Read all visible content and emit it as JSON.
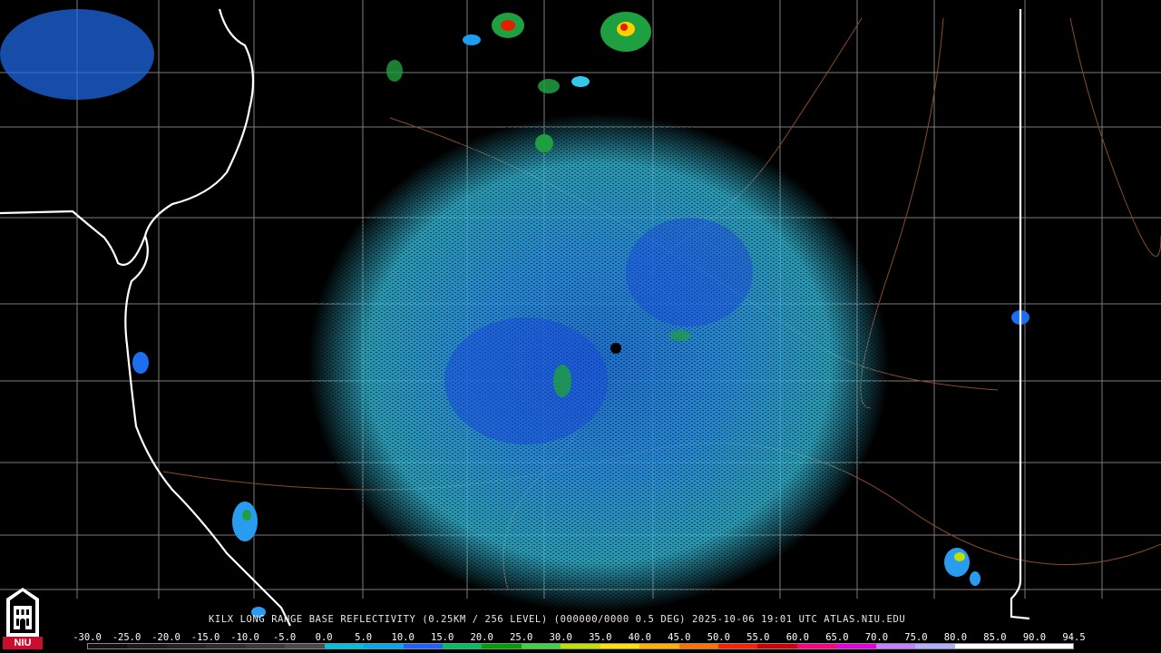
{
  "caption": "KILX LONG RANGE BASE REFLECTIVITY (0.25KM / 256 LEVEL) (000000/0000 0.5 DEG) 2025-10-06 19:01 UTC  ATLAS.NIU.EDU",
  "scale_labels": [
    "-30.0",
    "-25.0",
    "-20.0",
    "-15.0",
    "-10.0",
    "-5.0",
    "0.0",
    "5.0",
    "10.0",
    "15.0",
    "20.0",
    "25.0",
    "30.0",
    "35.0",
    "40.0",
    "45.0",
    "50.0",
    "55.0",
    "60.0",
    "65.0",
    "70.0",
    "75.0",
    "80.0",
    "85.0",
    "90.0",
    "94.5"
  ],
  "logo_text": "NIU",
  "colors": {
    "background": "#000000",
    "county_lines": "#8a8a8a",
    "state_lines": "#ffffff",
    "roads": "#8b4a2a",
    "radar_site": "#000000"
  },
  "scale_colors": [
    "#101010",
    "#1a1a1a",
    "#242424",
    "#2e2e2e",
    "#3a3a3a",
    "#4a4a4a",
    "#00c0e0",
    "#00a8f0",
    "#2060ff",
    "#00c060",
    "#00a000",
    "#40d040",
    "#c0e000",
    "#ffe000",
    "#ffb000",
    "#ff7000",
    "#ff2000",
    "#d00000",
    "#ff0080",
    "#e000e0",
    "#c080ff",
    "#b0b0ff",
    "#ffffff",
    "#ffffff",
    "#ffffff"
  ]
}
